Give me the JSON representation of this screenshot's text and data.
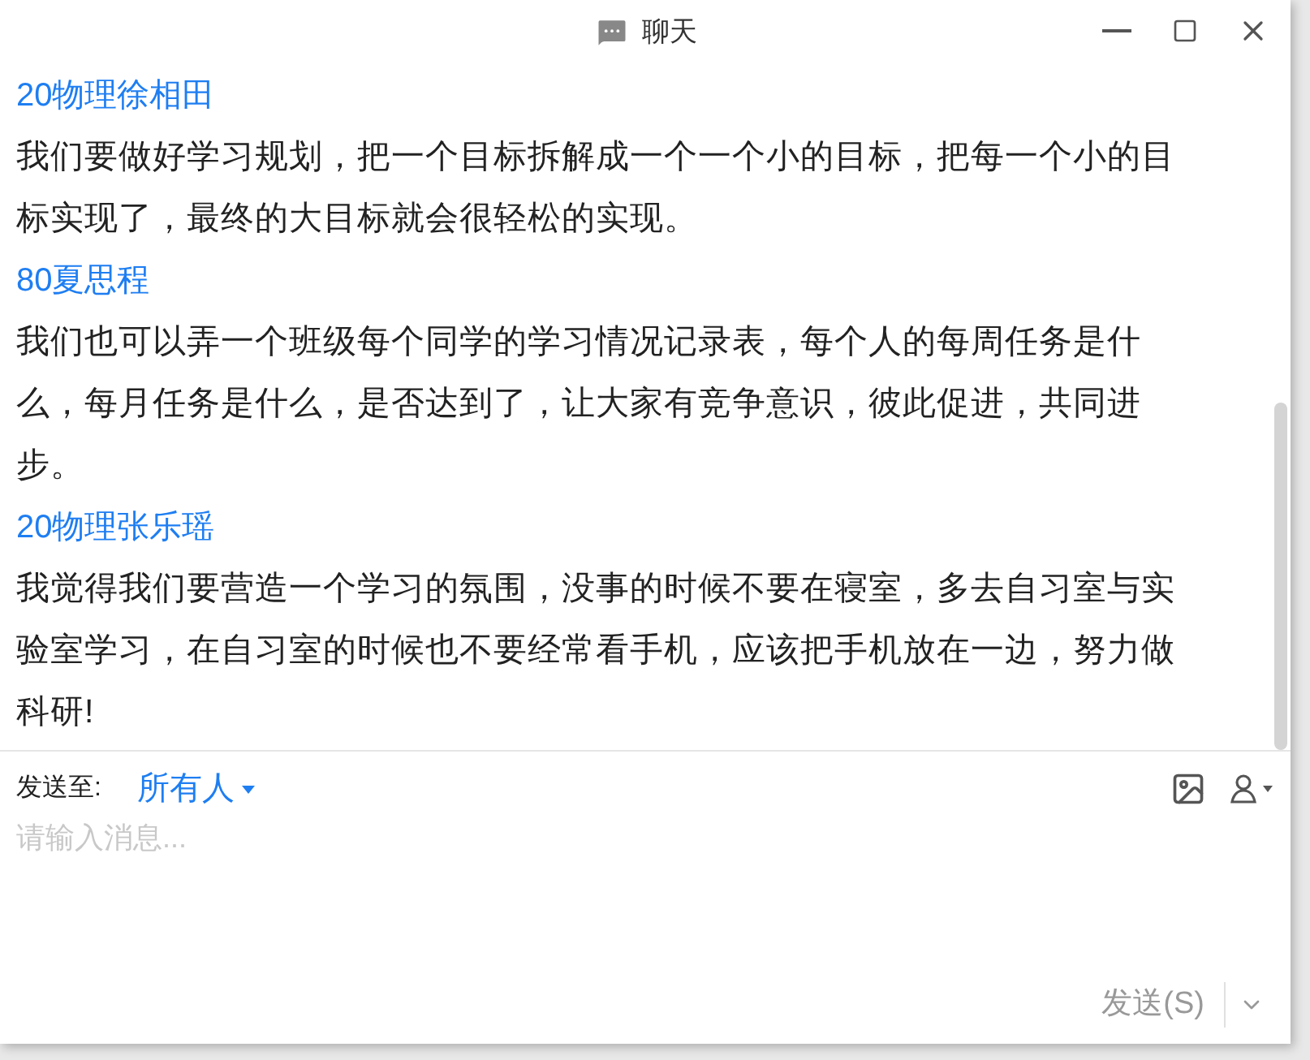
{
  "window": {
    "title": "聊天"
  },
  "messages": [
    {
      "sender": "20物理徐相田",
      "text": "我们要做好学习规划，把一个目标拆解成一个一个小的目标，把每一个小的目标实现了，最终的大目标就会很轻松的实现。"
    },
    {
      "sender": "80夏思程",
      "text": "我们也可以弄一个班级每个同学的学习情况记录表，每个人的每周任务是什么，每月任务是什么，是否达到了，让大家有竞争意识，彼此促进，共同进步。"
    },
    {
      "sender": "20物理张乐瑶",
      "text": "我觉得我们要营造一个学习的氛围，没事的时候不要在寝室，多去自习室与实验室学习，在自习室的时候也不要经常看手机，应该把手机放在一边，努力做科研!"
    }
  ],
  "compose": {
    "send_to_label": "发送至:",
    "recipient": "所有人",
    "placeholder": "请输入消息...",
    "send_button": "发送(S)"
  }
}
